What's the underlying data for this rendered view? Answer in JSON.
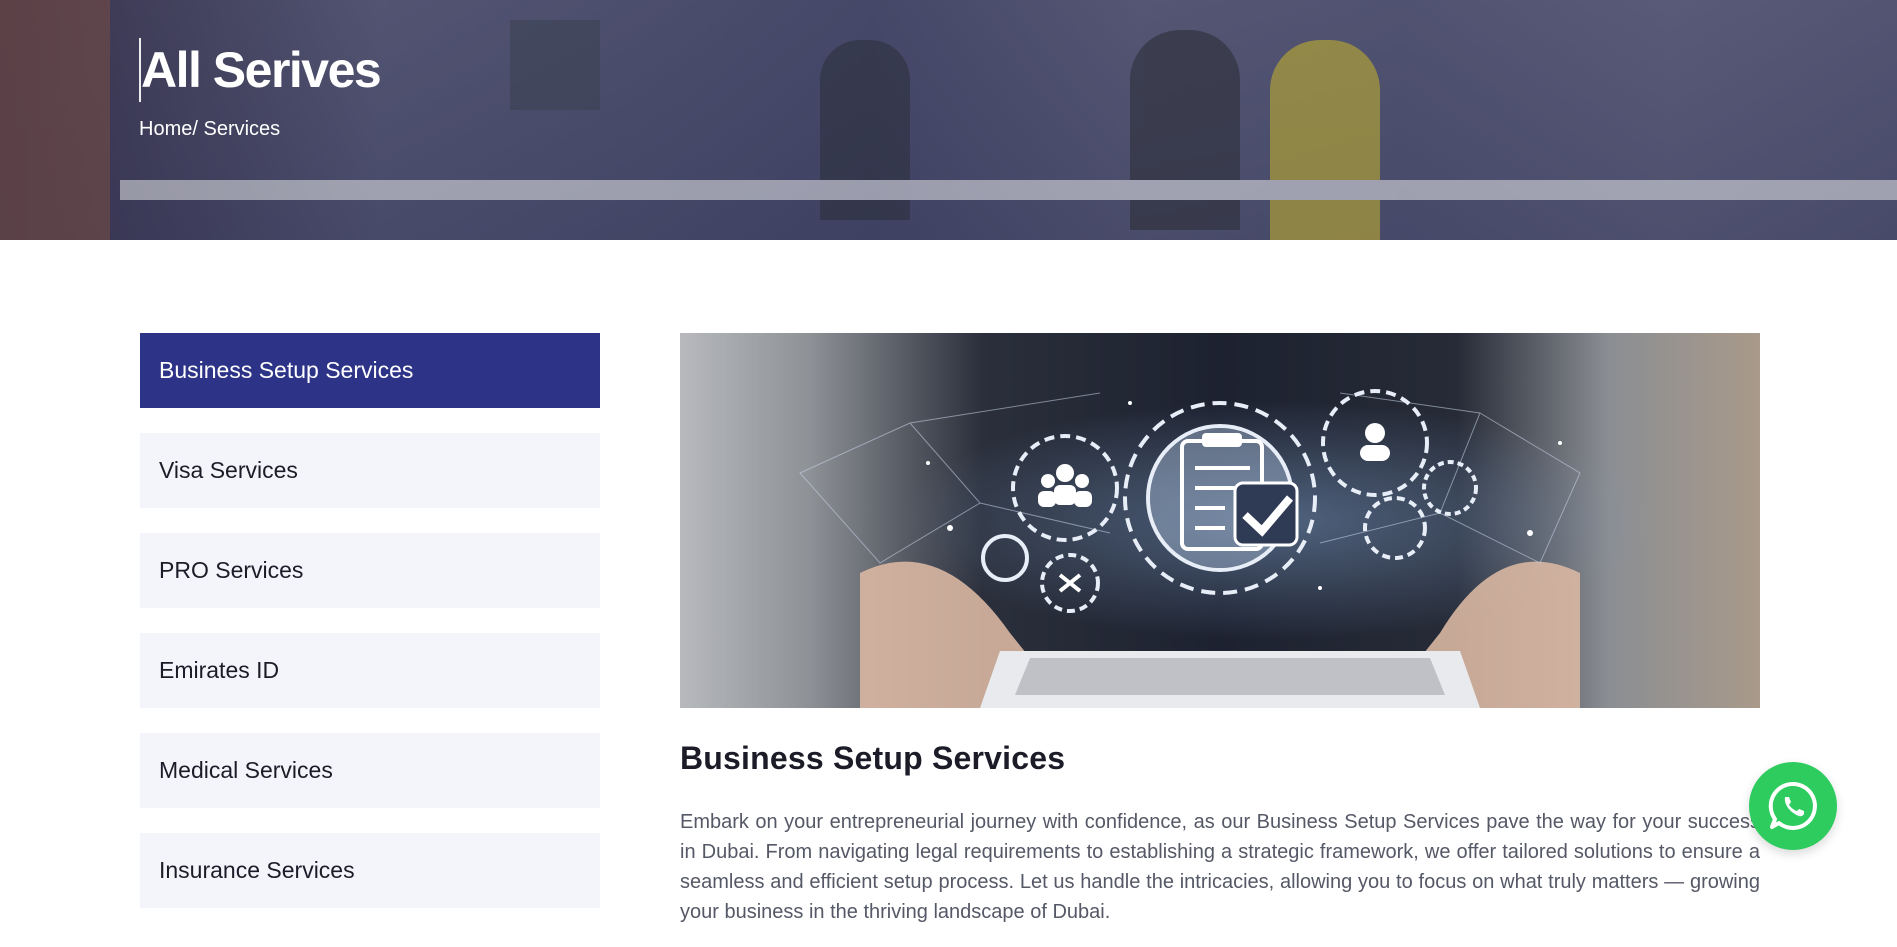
{
  "hero": {
    "title": "All Serives",
    "breadcrumb": {
      "home": "Home",
      "separator": "/ ",
      "current": "Services"
    }
  },
  "sidebar": {
    "items": [
      {
        "label": "Business Setup Services",
        "active": true
      },
      {
        "label": "Visa Services",
        "active": false
      },
      {
        "label": "PRO Services",
        "active": false
      },
      {
        "label": "Emirates ID",
        "active": false
      },
      {
        "label": "Medical Services",
        "active": false
      },
      {
        "label": "Insurance Services",
        "active": false
      }
    ]
  },
  "main": {
    "title": "Business Setup Services",
    "paragraph": "Embark on your entrepreneurial journey with confidence, as our Business Setup Services pave the way for your success in Dubai. From navigating legal requirements to establishing a strategic framework, we offer tailored solutions to ensure a seamless and efficient setup process. Let us handle the intricacies, allowing you to focus on what truly matters — growing your business in the thriving landscape of Dubai."
  },
  "colors": {
    "accent": "#2d3487",
    "sidebar_bg": "#f4f5fb",
    "whatsapp": "#2ecc5e"
  },
  "icons": {
    "whatsapp": "whatsapp-icon",
    "illustration": "gear-network-illustration"
  }
}
